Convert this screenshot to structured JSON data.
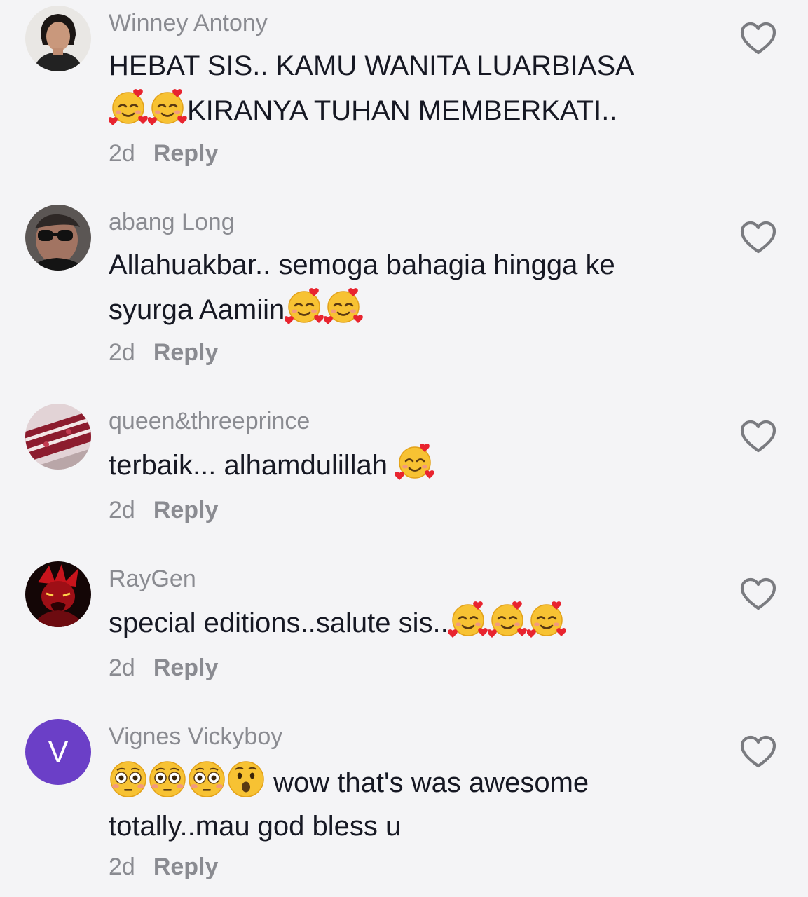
{
  "comments": [
    {
      "username": "Winney Antony",
      "text_lines": [
        "HEBAT SIS.. KAMU WANITA LUARBIASA",
        "KIRANYA TUHAN MEMBERKATI.."
      ],
      "time": "2d",
      "reply": "Reply",
      "avatar": "photo-woman"
    },
    {
      "username": "abang Long",
      "text_lines": [
        "Allahuakbar.. semoga bahagia hingga ke",
        "syurga Aamiin"
      ],
      "time": "2d",
      "reply": "Reply",
      "avatar": "photo-man-sunglasses"
    },
    {
      "username": "queen&threeprince",
      "text_lines": [
        "terbaik... alhamdulillah "
      ],
      "time": "2d",
      "reply": "Reply",
      "avatar": "photo-red-velvet-cake"
    },
    {
      "username": "RayGen",
      "text_lines": [
        "special editions..salute sis.."
      ],
      "time": "2d",
      "reply": "Reply",
      "avatar": "photo-red-anime"
    },
    {
      "username": "Vignes Vickyboy",
      "avatar_letter": "V",
      "text_lines": [
        " wow that's was awesome",
        "totally..mau god bless u"
      ],
      "time": "2d",
      "reply": "Reply",
      "avatar": "letter-avatar"
    }
  ],
  "icons": {
    "like": "heart-outline-icon",
    "emoji_love": "smiling-face-with-hearts",
    "emoji_flushed": "flushed-face",
    "emoji_astonished": "hushed-face"
  },
  "colors": {
    "background": "#f4f4f6",
    "username": "#8a8b91",
    "text": "#161823",
    "letter_avatar": "#6b3fc7"
  }
}
